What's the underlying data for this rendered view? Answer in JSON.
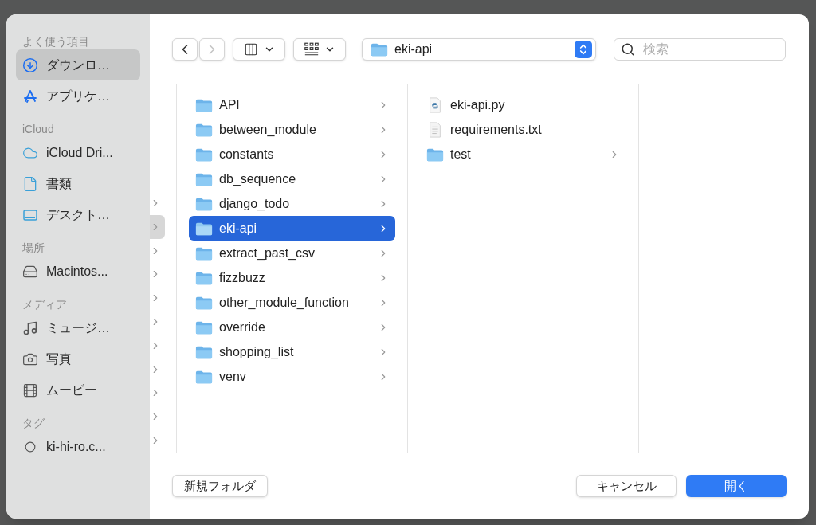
{
  "sidebar": {
    "sections": [
      {
        "heading": "よく使う項目",
        "items": [
          {
            "kind": "download",
            "label": "ダウンロ…",
            "selected": true
          },
          {
            "kind": "apps",
            "label": "アプリケ…",
            "selected": false
          }
        ]
      },
      {
        "heading": "iCloud",
        "items": [
          {
            "kind": "cloud",
            "label": "iCloud Dri...",
            "selected": false
          },
          {
            "kind": "document",
            "label": "書類",
            "selected": false
          },
          {
            "kind": "desktop",
            "label": "デスクト…",
            "selected": false
          }
        ]
      },
      {
        "heading": "場所",
        "items": [
          {
            "kind": "drive",
            "label": "Macintos...",
            "selected": false
          }
        ]
      },
      {
        "heading": "メディア",
        "items": [
          {
            "kind": "music",
            "label": "ミュージ…",
            "selected": false
          },
          {
            "kind": "camera",
            "label": "写真",
            "selected": false
          },
          {
            "kind": "film",
            "label": "ムービー",
            "selected": false
          }
        ]
      },
      {
        "heading": "タグ",
        "items": [
          {
            "kind": "tag",
            "label": "ki-hi-ro.c...",
            "selected": false
          }
        ]
      }
    ]
  },
  "toolbar": {
    "back_disabled": false,
    "forward_disabled": true,
    "path": "eki-api",
    "search": {
      "placeholder": "検索"
    }
  },
  "column_1": {
    "rows": [
      {
        "selected": false
      },
      {
        "selected": true
      },
      {
        "selected": false
      },
      {
        "selected": false
      },
      {
        "selected": false
      },
      {
        "selected": false
      },
      {
        "selected": false
      },
      {
        "selected": false
      },
      {
        "selected": false
      },
      {
        "selected": false
      },
      {
        "selected": false
      }
    ]
  },
  "column_2": {
    "items": [
      {
        "kind": "folder",
        "name": "API",
        "selected": false
      },
      {
        "kind": "folder",
        "name": "between_module",
        "selected": false
      },
      {
        "kind": "folder",
        "name": "constants",
        "selected": false
      },
      {
        "kind": "folder",
        "name": "db_sequence",
        "selected": false
      },
      {
        "kind": "folder",
        "name": "django_todo",
        "selected": false
      },
      {
        "kind": "folder",
        "name": "eki-api",
        "selected": true
      },
      {
        "kind": "folder",
        "name": "extract_past_csv",
        "selected": false
      },
      {
        "kind": "folder",
        "name": "fizzbuzz",
        "selected": false
      },
      {
        "kind": "folder",
        "name": "other_module_function",
        "selected": false
      },
      {
        "kind": "folder",
        "name": "override",
        "selected": false
      },
      {
        "kind": "folder",
        "name": "shopping_list",
        "selected": false
      },
      {
        "kind": "folder",
        "name": "venv",
        "selected": false
      }
    ]
  },
  "column_3": {
    "items": [
      {
        "kind": "python",
        "name": "eki-api.py",
        "selected": false
      },
      {
        "kind": "text",
        "name": "requirements.txt",
        "selected": false
      },
      {
        "kind": "folder",
        "name": "test",
        "selected": false
      }
    ]
  },
  "footer": {
    "new_folder": "新規フォルダ",
    "cancel": "キャンセル",
    "open": "開く"
  }
}
